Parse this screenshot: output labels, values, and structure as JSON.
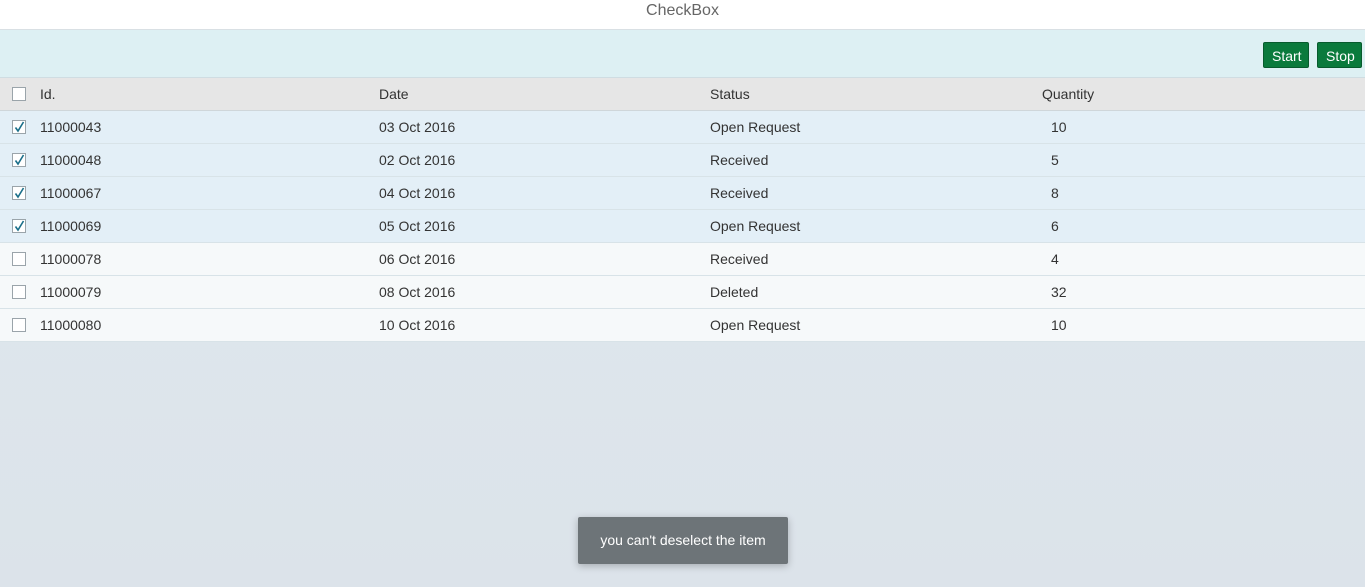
{
  "app": {
    "title": "CheckBox"
  },
  "toolbar": {
    "start_label": "Start",
    "stop_label": "Stop",
    "button_color": "#0a7a3c"
  },
  "table": {
    "columns": [
      "Id.",
      "Date",
      "Status",
      "Quantity"
    ],
    "rows": [
      {
        "id": "11000043",
        "date": "03 Oct 2016",
        "status": "Open Request",
        "quantity": "10",
        "checked": true
      },
      {
        "id": "11000048",
        "date": "02 Oct 2016",
        "status": "Received",
        "quantity": "5",
        "checked": true
      },
      {
        "id": "11000067",
        "date": "04 Oct 2016",
        "status": "Received",
        "quantity": "8",
        "checked": true
      },
      {
        "id": "11000069",
        "date": "05 Oct 2016",
        "status": "Open Request",
        "quantity": "6",
        "checked": true
      },
      {
        "id": "11000078",
        "date": "06 Oct 2016",
        "status": "Received",
        "quantity": "4",
        "checked": false
      },
      {
        "id": "11000079",
        "date": "08 Oct 2016",
        "status": "Deleted",
        "quantity": "32",
        "checked": false
      },
      {
        "id": "11000080",
        "date": "10 Oct 2016",
        "status": "Open Request",
        "quantity": "10",
        "checked": false
      }
    ]
  },
  "toast": {
    "message": "you can't deselect the item"
  }
}
